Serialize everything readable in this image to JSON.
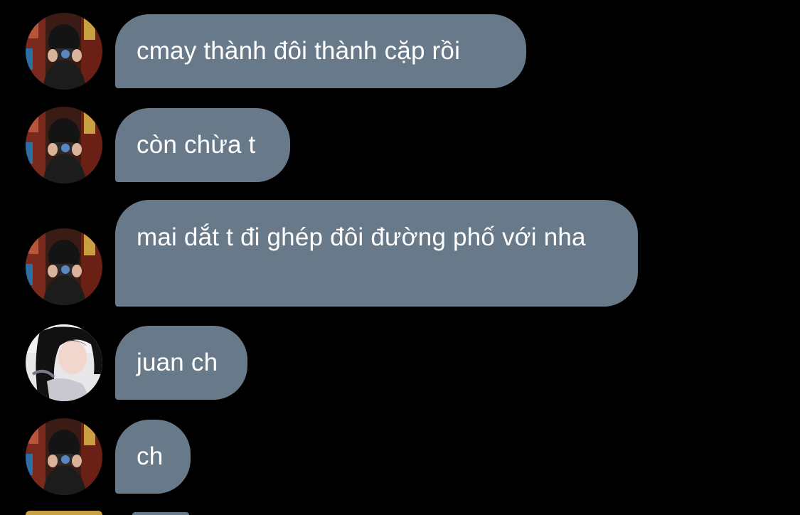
{
  "colors": {
    "background": "#000000",
    "bubble": "#687a8a",
    "text": "#ffffff"
  },
  "messages": [
    {
      "sender": "friend-camera",
      "text": "cmay thành đôi thành cặp rồi"
    },
    {
      "sender": "friend-camera",
      "text": "còn chừa t"
    },
    {
      "sender": "friend-camera",
      "text": "mai dắt t đi ghép đôi đường phố với nha"
    },
    {
      "sender": "friend-girl",
      "text": "juan ch"
    },
    {
      "sender": "friend-camera",
      "text": "ch"
    }
  ]
}
